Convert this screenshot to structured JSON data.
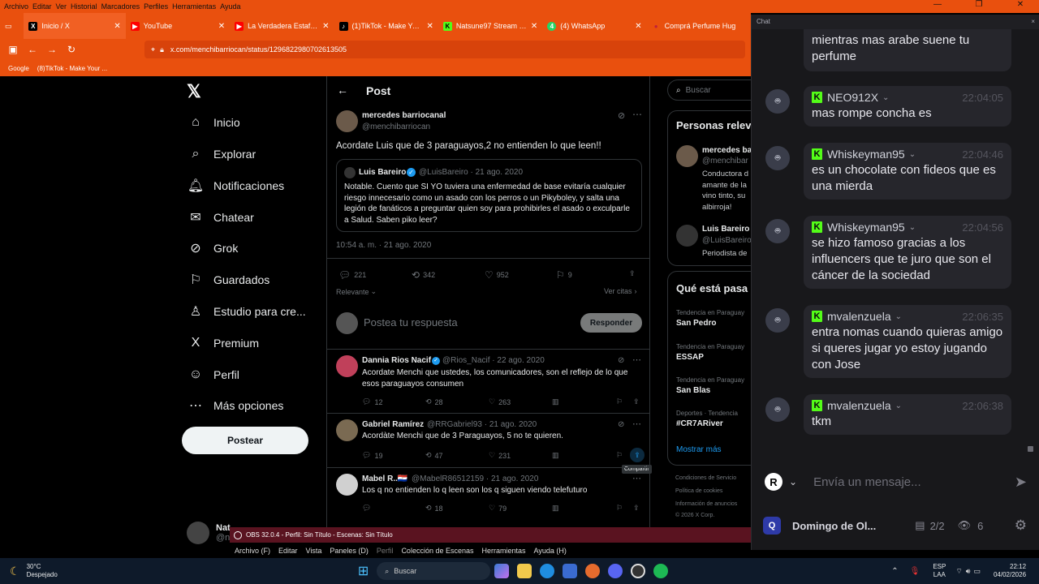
{
  "browser": {
    "menu": [
      "Archivo",
      "Editar",
      "Ver",
      "Historial",
      "Marcadores",
      "Perfiles",
      "Herramientas",
      "Ayuda"
    ],
    "tabs": [
      {
        "label": "Inicio / X",
        "icon": "X"
      },
      {
        "label": "YouTube",
        "icon": "▶"
      },
      {
        "label": "La Verdadera Estafa de la Pa",
        "icon": "▶"
      },
      {
        "label": "(1)TikTok - Make Your Day",
        "icon": "♪"
      },
      {
        "label": "Natsune97 Stream - Watch",
        "icon": "K"
      },
      {
        "label": "(4) WhatsApp",
        "icon": "4"
      },
      {
        "label": "Comprá Perfume Hug",
        "icon": "●"
      }
    ],
    "url": "x.com/menchibarriocan/status/1296822980702613505",
    "bookmarks": [
      "Google",
      "(8)TikTok - Make Your ..."
    ]
  },
  "xnav": {
    "items": [
      {
        "label": "Inicio",
        "icon": "⌂"
      },
      {
        "label": "Explorar",
        "icon": "⌕"
      },
      {
        "label": "Notificaciones",
        "icon": "🔔︎"
      },
      {
        "label": "Chatear",
        "icon": "✉"
      },
      {
        "label": "Grok",
        "icon": "⊘"
      },
      {
        "label": "Guardados",
        "icon": "⚐"
      },
      {
        "label": "Estudio para cre...",
        "icon": "♙"
      },
      {
        "label": "Premium",
        "icon": "X"
      },
      {
        "label": "Perfil",
        "icon": "☺"
      },
      {
        "label": "Más opciones",
        "icon": "⋯"
      }
    ],
    "post_button": "Postear",
    "user_name": "Nat",
    "user_handle": "@n"
  },
  "post": {
    "header": "Post",
    "author": "mercedes barriocanal",
    "handle": "@menchibarriocan",
    "text": "Acordate Luis que de 3 paraguayos,2 no entienden lo que leen!!",
    "quote_author": "Luis Bareiro",
    "quote_meta": "@LuisBareiro · 21 ago. 2020",
    "quote_text": "Notable. Cuento que SI YO tuviera una enfermedad de base evitaría cualquier riesgo innecesario como un asado con los perros o un Pikyboley, y salta una legión de fanáticos a preguntar quien soy para prohibirles el asado o exculparle a Salud. Saben piko leer?",
    "timestamp": "10:54 a. m. · 21 ago. 2020",
    "replies": "221",
    "reposts": "342",
    "likes": "952",
    "bookmarks": "9",
    "relevance": "Relevante",
    "quotes_link": "Ver citas",
    "reply_placeholder": "Postea tu respuesta",
    "reply_button": "Responder"
  },
  "replies": [
    {
      "author": "Dannia Rios Nacif",
      "meta": "@Rios_Nacif · 22 ago. 2020",
      "text": "Acordate Menchi que ustedes, los comunicadores, son el reflejo de lo que esos paraguayos consumen",
      "replies": "12",
      "reposts": "28",
      "likes": "263",
      "color": "#c0405a"
    },
    {
      "author": "Gabriel Ramírez",
      "meta": "@RRGabriel93 · 21 ago. 2020",
      "text": "Acordàte Menchi que de 3 Paraguayos, 5 no te quieren.",
      "replies": "19",
      "reposts": "47",
      "likes": "231",
      "color": "#7a6a52"
    },
    {
      "author": "Mabel R..🇵🇾",
      "meta": "@MabelR86512159 · 21 ago. 2020",
      "text": "Los q no entienden lo q leen son los q siguen viendo telefuturo",
      "replies": "",
      "reposts": "18",
      "likes": "79",
      "color": "#d0d0d0"
    }
  ],
  "share_tooltip": "Compartir",
  "right": {
    "search_placeholder": "Buscar",
    "people_title": "Personas relev",
    "people": [
      {
        "name": "mercedes ba",
        "handle": "@menchibar",
        "bio": "Conductora d amante de la vino tinto, su albirroja!"
      },
      {
        "name": "Luis Bareiro",
        "handle": "@LuisBareiro",
        "bio": "Periodista de"
      }
    ],
    "trends_title": "Qué está pasa",
    "trends": [
      {
        "ctx": "Tendencia en Paraguay",
        "name": "San Pedro"
      },
      {
        "ctx": "Tendencia en Paraguay",
        "name": "ESSAP"
      },
      {
        "ctx": "Tendencia en Paraguay",
        "name": "San Blas"
      },
      {
        "ctx": "Deportes · Tendencia",
        "name": "#CR7ARiver"
      }
    ],
    "show_more": "Mostrar más",
    "footer": [
      "Condiciones de Servicio",
      "Política de cookies",
      "Información de anuncios",
      "© 2026 X Corp."
    ]
  },
  "chat": {
    "title": "Chat",
    "partial_top": "mientras mas arabe suene tu perfume",
    "messages": [
      {
        "user": "NEO912X",
        "time": "22:04:05",
        "text": "mas rompe concha es"
      },
      {
        "user": "Whiskeyman95",
        "time": "22:04:46",
        "text": "es un chocolate con fideos que es una mierda"
      },
      {
        "user": "Whiskeyman95",
        "time": "22:04:56",
        "text": "se hizo famoso gracias a los influencers que te juro que son el cáncer de la sociedad"
      },
      {
        "user": "mvalenzuela",
        "time": "22:06:35",
        "text": "entra nomas cuando quieras amigo si queres jugar yo estoy jugando con Jose"
      },
      {
        "user": "mvalenzuela",
        "time": "22:06:38",
        "text": "tkm"
      }
    ],
    "input_placeholder": "Envía un mensaje...",
    "user_badge": "R",
    "footer_name": "Domingo de Ol...",
    "slots": "2/2",
    "viewers": "6"
  },
  "obs": {
    "title": "OBS 32.0.4 - Perfil: Sin Título - Escenas: Sin Título",
    "menu": [
      "Archivo (F)",
      "Editar",
      "Vista",
      "Paneles (D)",
      "Perfil",
      "Colección de Escenas",
      "Herramientas",
      "Ayuda (H)"
    ]
  },
  "taskbar": {
    "temp": "30°C",
    "weather": "Despejado",
    "search": "Buscar",
    "lang1": "ESP",
    "lang2": "LAA",
    "time": "22:12",
    "date": "04/02/2026"
  }
}
